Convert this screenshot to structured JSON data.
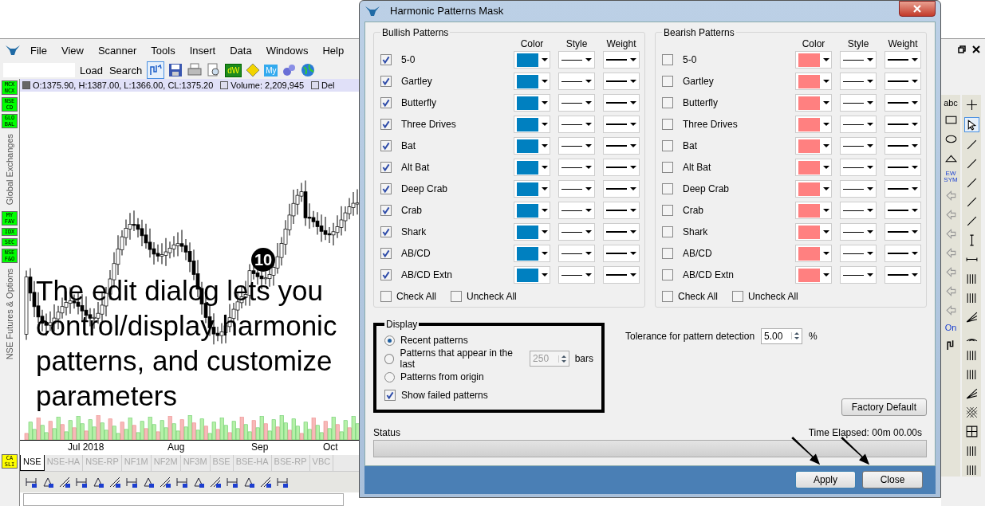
{
  "app": {
    "menu": [
      "File",
      "View",
      "Scanner",
      "Tools",
      "Insert",
      "Data",
      "Windows",
      "Help"
    ],
    "toolbar": {
      "buttons": [
        "Load",
        "Search"
      ],
      "badges": [
        "dW",
        "My"
      ]
    },
    "sidebar": {
      "groups": [
        {
          "label": "Global Exchanges",
          "tiles": [
            {
              "text": "MCX NCX",
              "color": "#00ff00"
            },
            {
              "text": "NSE CD",
              "color": "#00ff00"
            },
            {
              "text": "GLO BAL",
              "color": "#00ff00"
            }
          ]
        },
        {
          "label": "NSE Futures & Options",
          "tiles": [
            {
              "text": "MY FAV",
              "color": "#00ff00"
            },
            {
              "text": "IDX",
              "color": "#00ff00"
            },
            {
              "text": "SEC",
              "color": "#00ff00"
            },
            {
              "text": "NSE F&O",
              "color": "#00ff00"
            }
          ]
        }
      ],
      "bottom_tile": {
        "text": "CA SLI",
        "color": "#ffff00"
      }
    },
    "chart": {
      "ohlc": "O:1375.90, H:1387.00, L:1366.00, CL:1375.20",
      "volume": "Volume: 2,209,945",
      "cut_label": "Del",
      "x_labels": [
        "Jul 2018",
        "Aug",
        "Sep",
        "Oct"
      ],
      "annotation": "The edit dialog lets you control/display harmonic patterns, and customize parameters",
      "step_badge": "10"
    },
    "exchange_tabs": [
      {
        "label": "NSE",
        "selected": true
      },
      {
        "label": "NSE-HA",
        "selected": false
      },
      {
        "label": "NSE-RP",
        "selected": false
      },
      {
        "label": "NF1M",
        "selected": false
      },
      {
        "label": "NF2M",
        "selected": false
      },
      {
        "label": "NF3M",
        "selected": false
      },
      {
        "label": "BSE",
        "selected": false
      },
      {
        "label": "BSE-HA",
        "selected": false
      },
      {
        "label": "BSE-RP",
        "selected": false
      },
      {
        "label": "VBC",
        "selected": false
      }
    ],
    "right_toolbar": {
      "labels": [
        "abc",
        "EW SYM",
        "On"
      ]
    }
  },
  "dialog": {
    "title": "Harmonic Patterns Mask",
    "groups": [
      {
        "title": "Bullish Patterns",
        "columns": [
          "Color",
          "Style",
          "Weight"
        ],
        "patterns": [
          {
            "name": "5-0",
            "checked": true,
            "color": "#0080c0"
          },
          {
            "name": "Gartley",
            "checked": true,
            "color": "#0080c0"
          },
          {
            "name": "Butterfly",
            "checked": true,
            "color": "#0080c0"
          },
          {
            "name": "Three Drives",
            "checked": true,
            "color": "#0080c0"
          },
          {
            "name": "Bat",
            "checked": true,
            "color": "#0080c0"
          },
          {
            "name": "Alt Bat",
            "checked": true,
            "color": "#0080c0"
          },
          {
            "name": "Deep Crab",
            "checked": true,
            "color": "#0080c0"
          },
          {
            "name": "Crab",
            "checked": true,
            "color": "#0080c0"
          },
          {
            "name": "Shark",
            "checked": true,
            "color": "#0080c0"
          },
          {
            "name": "AB/CD",
            "checked": true,
            "color": "#0080c0"
          },
          {
            "name": "AB/CD Extn",
            "checked": true,
            "color": "#0080c0"
          }
        ],
        "actions": [
          {
            "label": "Check All",
            "checked": false
          },
          {
            "label": "Uncheck All",
            "checked": false
          }
        ]
      },
      {
        "title": "Bearish Patterns",
        "columns": [
          "Color",
          "Style",
          "Weight"
        ],
        "patterns": [
          {
            "name": "5-0",
            "checked": false,
            "color": "#ff8080"
          },
          {
            "name": "Gartley",
            "checked": false,
            "color": "#ff8080"
          },
          {
            "name": "Butterfly",
            "checked": false,
            "color": "#ff8080"
          },
          {
            "name": "Three Drives",
            "checked": false,
            "color": "#ff8080"
          },
          {
            "name": "Bat",
            "checked": false,
            "color": "#ff8080"
          },
          {
            "name": "Alt Bat",
            "checked": false,
            "color": "#ff8080"
          },
          {
            "name": "Deep Crab",
            "checked": false,
            "color": "#ff8080"
          },
          {
            "name": "Crab",
            "checked": false,
            "color": "#ff8080"
          },
          {
            "name": "Shark",
            "checked": false,
            "color": "#ff8080"
          },
          {
            "name": "AB/CD",
            "checked": false,
            "color": "#ff8080"
          },
          {
            "name": "AB/CD Extn",
            "checked": false,
            "color": "#ff8080"
          }
        ],
        "actions": [
          {
            "label": "Check All",
            "checked": false
          },
          {
            "label": "Uncheck All",
            "checked": false
          }
        ]
      }
    ],
    "display": {
      "title": "Display",
      "options": [
        {
          "label": "Recent patterns",
          "selected": true
        },
        {
          "label": "Patterns that appear in the last",
          "selected": false,
          "value": "250",
          "suffix": "bars"
        },
        {
          "label": "Patterns from origin",
          "selected": false
        }
      ],
      "show_failed": {
        "label": "Show failed patterns",
        "checked": true
      }
    },
    "tolerance": {
      "label": "Tolerance for pattern detection",
      "value": "5.00",
      "unit": "%"
    },
    "factory_default": "Factory Default",
    "status": {
      "label": "Status",
      "elapsed": "Time Elapsed: 00m 00.00s",
      "level": 0
    },
    "buttons": [
      "Apply",
      "Close"
    ]
  }
}
